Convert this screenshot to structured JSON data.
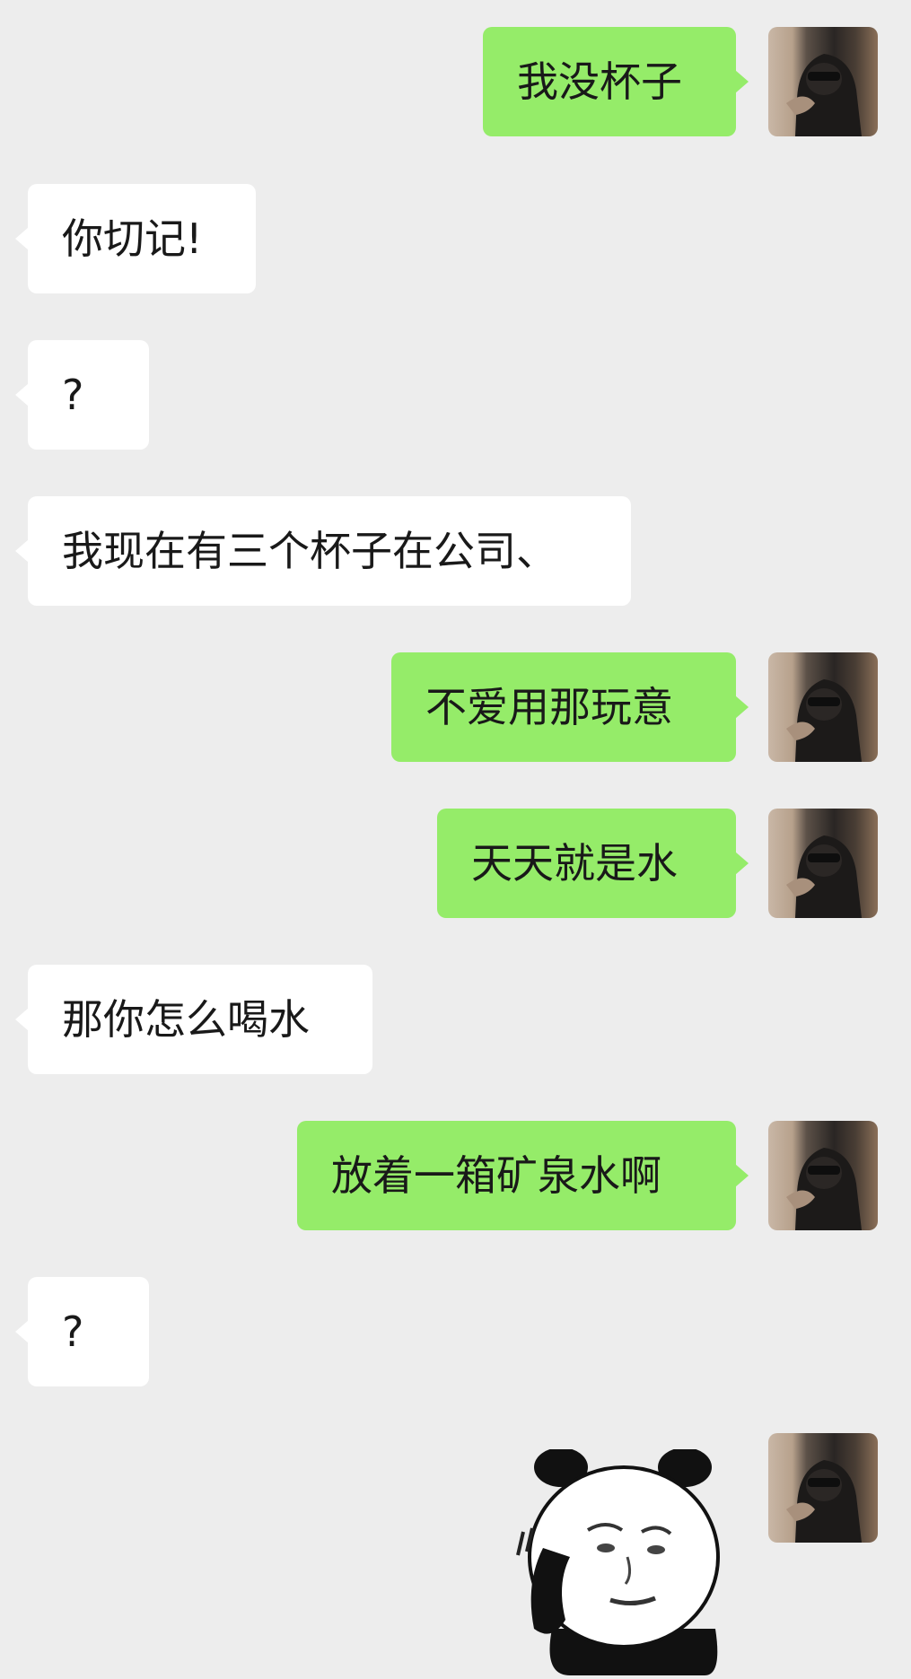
{
  "chat": {
    "messages": [
      {
        "side": "self",
        "text": "我没杯子"
      },
      {
        "side": "other",
        "text": "你切记!"
      },
      {
        "side": "other",
        "text": "?"
      },
      {
        "side": "other",
        "text": "我现在有三个杯子在公司、"
      },
      {
        "side": "self",
        "text": "不爱用那玩意"
      },
      {
        "side": "self",
        "text": "天天就是水"
      },
      {
        "side": "other",
        "text": "那你怎么喝水"
      },
      {
        "side": "self",
        "text": "放着一箱矿泉水啊"
      },
      {
        "side": "other",
        "text": "?"
      },
      {
        "side": "self",
        "sticker": "panda-meme-sticker"
      }
    ]
  },
  "colors": {
    "background": "#ededed",
    "self_bubble": "#95ec69",
    "other_bubble": "#ffffff",
    "text": "#191919"
  },
  "icons": {
    "avatar": "hooded-person-avatar",
    "sticker": "panda-meme-sticker"
  }
}
